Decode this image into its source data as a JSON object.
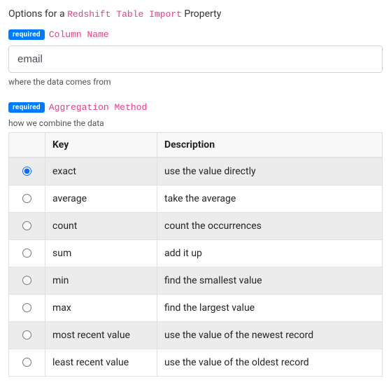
{
  "heading_prefix": "Options for a ",
  "heading_code": "Redshift Table Import",
  "heading_suffix": " Property",
  "required_label": "required",
  "column_name_field": {
    "label": "Column Name",
    "value": "email",
    "help": "where the data comes from"
  },
  "aggregation_field": {
    "label": "Aggregation Method",
    "help": "how we combine the data"
  },
  "table": {
    "headers": {
      "key": "Key",
      "description": "Description"
    },
    "rows": [
      {
        "key": "exact",
        "description": "use the value directly",
        "selected": true
      },
      {
        "key": "average",
        "description": "take the average",
        "selected": false
      },
      {
        "key": "count",
        "description": "count the occurrences",
        "selected": false
      },
      {
        "key": "sum",
        "description": "add it up",
        "selected": false
      },
      {
        "key": "min",
        "description": "find the smallest value",
        "selected": false
      },
      {
        "key": "max",
        "description": "find the largest value",
        "selected": false
      },
      {
        "key": "most recent value",
        "description": "use the value of the newest record",
        "selected": false
      },
      {
        "key": "least recent value",
        "description": "use the value of the oldest record",
        "selected": false
      }
    ]
  }
}
